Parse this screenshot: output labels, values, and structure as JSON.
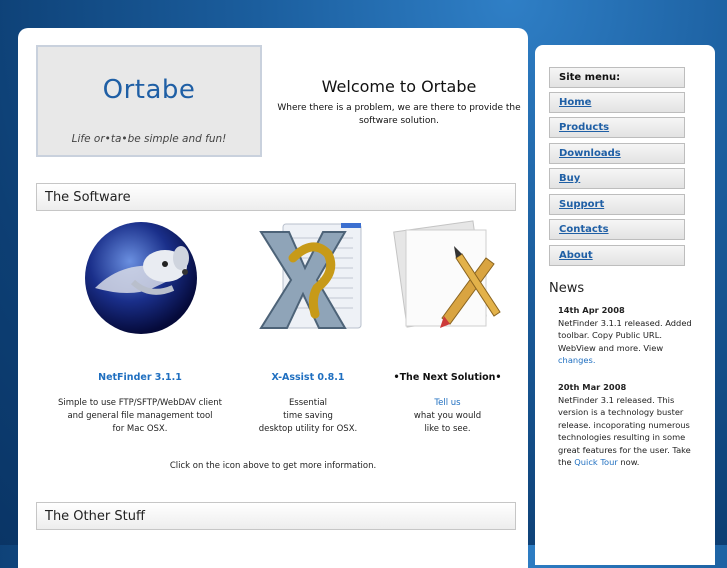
{
  "logo": {
    "title": "Ortabe",
    "tagline": "Life or•ta•be simple and fun!"
  },
  "welcome": {
    "title": "Welcome to Ortabe",
    "text": "Where there is a problem, we are there to provide the software solution."
  },
  "sections": {
    "software": "The Software",
    "other": "The Other Stuff"
  },
  "products": [
    {
      "name": "NetFinder 3.1.1",
      "icon": "netfinder-dog-globe-icon",
      "desc_lines": [
        "Simple to use FTP/SFTP/WebDAV client",
        "and general file management tool",
        "for Mac OSX."
      ]
    },
    {
      "name": "X-Assist 0.8.1",
      "icon": "x-assist-x-icon",
      "desc_lines": [
        "Essential",
        "time saving",
        "desktop utility for OSX."
      ]
    },
    {
      "name": "•The Next Solution•",
      "icon": "pencil-ruler-paper-icon",
      "link": "Tell us",
      "desc_lines": [
        "what you would",
        "like to see."
      ]
    }
  ],
  "click_note": "Click on the icon above to get more information.",
  "site_menu": {
    "heading": "Site menu:",
    "items": [
      "Home",
      "Products",
      "Downloads",
      "Buy",
      "Support",
      "Contacts",
      "About"
    ]
  },
  "news": {
    "title": "News",
    "items": [
      {
        "date": "14th Apr 2008",
        "text": "NetFinder 3.1.1 released. Added toolbar. Copy Public URL. WebView and more. View",
        "link": "changes."
      },
      {
        "date": "20th Mar 2008",
        "text": "NetFinder 3.1 released. This version is a technology buster release. incoporating numerous technologies resulting in some great features for the user. Take the",
        "link": "Quick Tour",
        "tail": "now."
      }
    ]
  },
  "colors": {
    "link": "#1f6fc0",
    "background": "#1b5e9e",
    "panel": "#ffffff"
  }
}
